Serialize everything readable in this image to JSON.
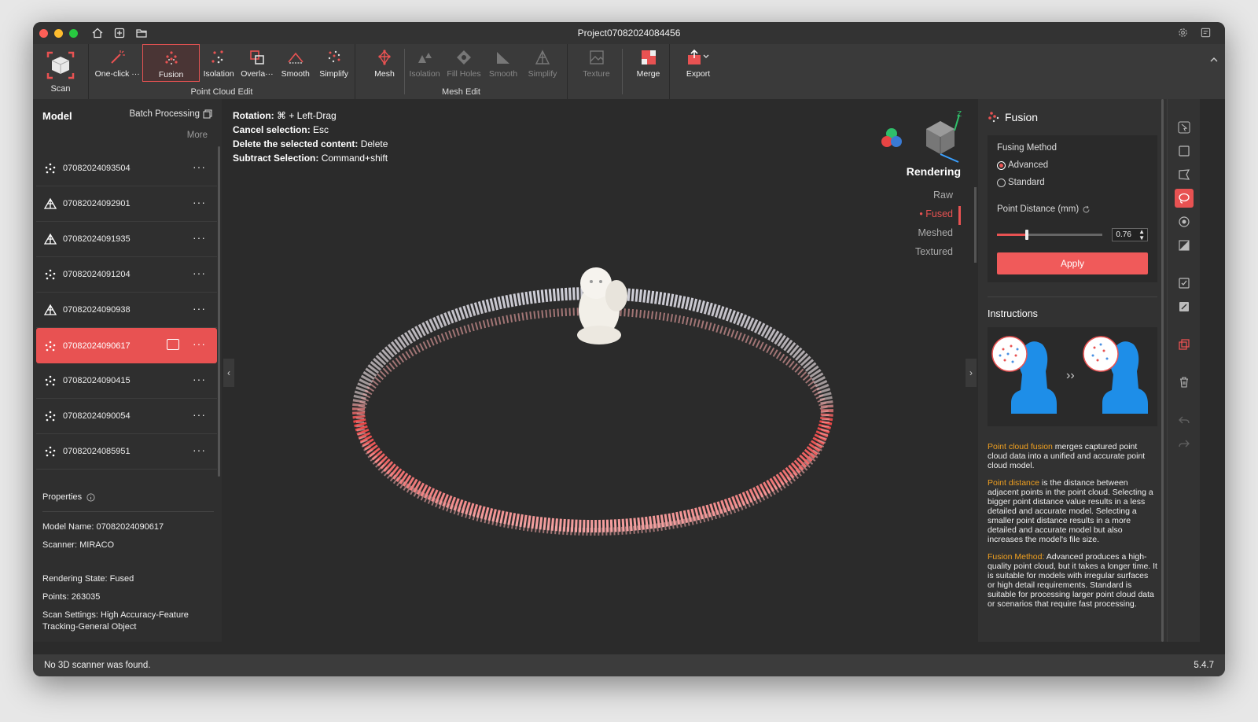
{
  "window": {
    "title": "Project07082024084456",
    "traffic_colors": [
      "#fe5f57",
      "#febc2e",
      "#28c840"
    ]
  },
  "ribbon": {
    "scan_label": "Scan",
    "point_cloud_group_label": "Point Cloud Edit",
    "mesh_group_label": "Mesh Edit",
    "point_cloud_tools": [
      {
        "label": "One-click ···",
        "icon": "wand-icon"
      },
      {
        "label": "Fusion",
        "icon": "fusion-icon"
      },
      {
        "label": "Isolation",
        "icon": "isolation-icon"
      },
      {
        "label": "Overla···",
        "icon": "overlap-icon"
      },
      {
        "label": "Smooth",
        "icon": "smooth-icon"
      },
      {
        "label": "Simplify",
        "icon": "simplify-icon"
      }
    ],
    "mesh_label": "Mesh",
    "mesh_tools": [
      {
        "label": "Isolation"
      },
      {
        "label": "Fill Holes"
      },
      {
        "label": "Smooth"
      },
      {
        "label": "Simplify"
      }
    ],
    "texture_label": "Texture",
    "merge_label": "Merge",
    "export_label": "Export"
  },
  "left_panel": {
    "title": "Model",
    "batch_label": "Batch Processing",
    "more_label": "More",
    "models": [
      {
        "name": "07082024093504",
        "type": "points"
      },
      {
        "name": "07082024092901",
        "type": "mesh"
      },
      {
        "name": "07082024091935",
        "type": "mesh"
      },
      {
        "name": "07082024091204",
        "type": "points"
      },
      {
        "name": "07082024090938",
        "type": "mesh"
      },
      {
        "name": "07082024090617",
        "type": "points",
        "selected": true
      },
      {
        "name": "07082024090415",
        "type": "points"
      },
      {
        "name": "07082024090054",
        "type": "points"
      },
      {
        "name": "07082024085951",
        "type": "points"
      }
    ],
    "properties_title": "Properties",
    "properties": {
      "model_name_label": "Model Name:",
      "model_name": "07082024090617",
      "scanner_label": "Scanner:",
      "scanner": "MIRACO",
      "rendering_state_label": "Rendering State:",
      "rendering_state": "Fused",
      "points_label": "Points:",
      "points": "263035",
      "scan_settings_label": "Scan Settings:",
      "scan_settings": "High Accuracy-Feature Tracking-General Object"
    }
  },
  "viewport": {
    "hints": [
      {
        "label": "Rotation:",
        "value": "⌘ + Left-Drag"
      },
      {
        "label": "Cancel selection:",
        "value": "Esc"
      },
      {
        "label": "Delete the selected content:",
        "value": "Delete"
      },
      {
        "label": "Subtract Selection:",
        "value": "Command+shift"
      }
    ],
    "axis_z_label": "Z",
    "rendering_title": "Rendering",
    "rendering_modes": [
      "Raw",
      "Fused",
      "Meshed",
      "Textured"
    ],
    "active_mode": "Fused"
  },
  "right_panel": {
    "title": "Fusion",
    "fusing_method_label": "Fusing Method",
    "methods": [
      "Advanced",
      "Standard"
    ],
    "selected_method": "Advanced",
    "point_distance_label": "Point Distance (mm)",
    "point_distance_value": "0.76",
    "point_distance_fraction": 0.28,
    "apply_label": "Apply",
    "instructions_title": "Instructions",
    "paragraphs": [
      {
        "highlight": "Point cloud fusion",
        "text": " merges captured point cloud data into a unified and accurate point cloud model."
      },
      {
        "highlight": "Point distance",
        "text": " is the distance between adjacent points in the point cloud. Selecting a bigger point distance value results in a less detailed and accurate model. Selecting a smaller point distance results in a more detailed and accurate model but also increases the model's file size."
      },
      {
        "highlight": "Fusion Method:",
        "text": " Advanced produces a high-quality point cloud, but it takes a longer time. It is suitable for models with irregular surfaces or high detail requirements. Standard is suitable for processing larger point cloud data or scenarios that require fast processing."
      }
    ]
  },
  "status": {
    "message": "No 3D scanner was found.",
    "version": "5.4.7"
  },
  "colors": {
    "accent": "#e85252",
    "highlight_text": "#f0a020"
  }
}
